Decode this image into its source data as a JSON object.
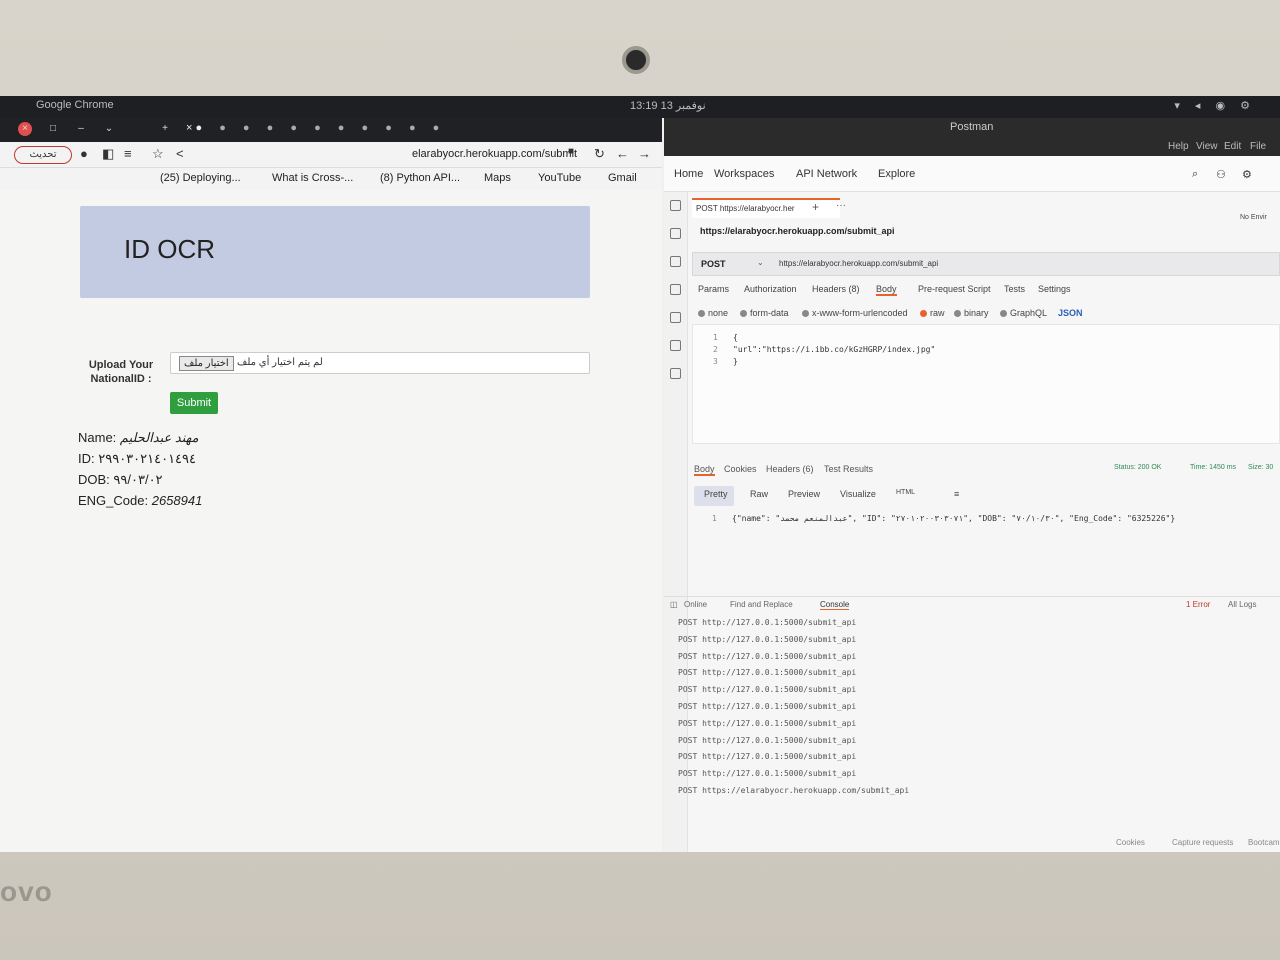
{
  "os_bar": {
    "app_name": "Google Chrome",
    "clock": "13:19 13 نوفمبر"
  },
  "chrome": {
    "refresh_label": "تحديث",
    "url": "elarabyocr.herokuapp.com/submit",
    "bookmarks": [
      "(25) Deploying...",
      "What is Cross-...",
      "(8) Python API...",
      "Maps",
      "YouTube",
      "Gmail"
    ],
    "page": {
      "title": "ID OCR",
      "upload_label": "Upload Your NationalID :",
      "file_button": "اختيار ملف",
      "file_status": "لم يتم اختيار أي ملف",
      "submit_label": "Submit",
      "results": {
        "name_label": "Name:",
        "name_value": "مهند عبدالحليم",
        "id_label": "ID:",
        "id_value": "٢٩٩٠٣٠٢١٤٠١٤٩٤",
        "dob_label": "DOB:",
        "dob_value": "٩٩/٠٣/٠٢",
        "eng_label": "ENG_Code:",
        "eng_value": "2658941"
      }
    }
  },
  "postman": {
    "window_title": "Postman",
    "menu": [
      "Help",
      "View",
      "Edit",
      "File"
    ],
    "nav": [
      "Home",
      "Workspaces",
      "API Network",
      "Explore"
    ],
    "tab_label": "POST https://elarabyocr.her",
    "env_label": "No Envir",
    "request_title": "https://elarabyocr.herokuapp.com/submit_api",
    "method": "POST",
    "request_url": "https://elarabyocr.herokuapp.com/submit_api",
    "request_tabs": [
      "Params",
      "Authorization",
      "Headers (8)",
      "Body",
      "Pre-request Script",
      "Tests",
      "Settings"
    ],
    "body_options": [
      "none",
      "form-data",
      "x-www-form-urlencoded",
      "raw",
      "binary",
      "GraphQL",
      "JSON"
    ],
    "editor_lines": [
      "{",
      "    \"url\":\"https://i.ibb.co/kGzHGRP/index.jpg\"",
      "}"
    ],
    "response_tabs": [
      "Body",
      "Cookies",
      "Headers (6)",
      "Test Results"
    ],
    "response_status": "Status: 200 OK",
    "response_time": "Time: 1450 ms",
    "response_size": "Size: 30",
    "response_views": [
      "Pretty",
      "Raw",
      "Preview",
      "Visualize",
      "HTML"
    ],
    "response_line": "{\"name\": \"عبدالمنعم محمد\", \"ID\": \"٢٧٠١٠٢٠٠٣٠٣٠٧١\", \"DOB\": \"٧٠/١٠/٣٠\", \"Eng_Code\": \"6325226\"}",
    "console_bar": [
      "Online",
      "Find and Replace",
      "Console"
    ],
    "console_errors": "1 Error",
    "console_logs_label": "All Logs",
    "logs": [
      "POST http://127.0.0.1:5000/submit_api",
      "POST http://127.0.0.1:5000/submit_api",
      "POST http://127.0.0.1:5000/submit_api",
      "POST http://127.0.0.1:5000/submit_api",
      "POST http://127.0.0.1:5000/submit_api",
      "POST http://127.0.0.1:5000/submit_api",
      "POST http://127.0.0.1:5000/submit_api",
      "POST http://127.0.0.1:5000/submit_api",
      "POST http://127.0.0.1:5000/submit_api",
      "POST http://127.0.0.1:5000/submit_api",
      "POST https://elarabyocr.herokuapp.com/submit_api"
    ],
    "statusbar": [
      "Cookies",
      "Capture requests",
      "Bootcamp"
    ]
  },
  "laptop": {
    "brand": "ovo"
  },
  "colors": {
    "submit_green": "#2e9e3e",
    "hero_blue": "#c3cbe2",
    "postman_orange": "#e8632c"
  }
}
